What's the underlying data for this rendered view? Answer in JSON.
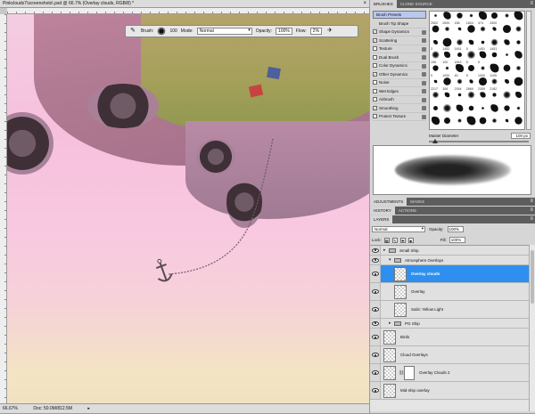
{
  "document": {
    "title": "Pinkclouds7\\screenshots\\.psd @ 66.7% (Overlay clouds, RGB/8) *",
    "close": "×",
    "status_zoom": "66.67%",
    "status_doc": "Doc: 50.0M/812.5M",
    "status_arrow": "▸"
  },
  "options_bar": {
    "brush_label": "Brush:",
    "brush_size": "100",
    "mode_label": "Mode:",
    "mode_value": "Normal",
    "opacity_label": "Opacity:",
    "opacity_value": "100%",
    "flow_label": "Flow:",
    "flow_value": "2%",
    "tool_icon": "brush-icon",
    "airbrush_icon": "airbrush-icon"
  },
  "brushes_panel": {
    "tabs": [
      "BRUSHES",
      "CLONE SOURCE"
    ],
    "presets_button": "Brush Presets",
    "options": [
      {
        "label": "Brush Tip Shape",
        "checkbox": false,
        "checked": false
      },
      {
        "label": "Shape Dynamics",
        "checkbox": true,
        "checked": true
      },
      {
        "label": "Scattering",
        "checkbox": true,
        "checked": true
      },
      {
        "label": "Texture",
        "checkbox": true,
        "checked": false
      },
      {
        "label": "Dual Brush",
        "checkbox": true,
        "checked": false
      },
      {
        "label": "Color Dynamics",
        "checkbox": true,
        "checked": false
      },
      {
        "label": "Other Dynamics",
        "checkbox": true,
        "checked": true
      },
      {
        "label": "Noise",
        "checkbox": true,
        "checked": false
      },
      {
        "label": "Wet Edges",
        "checkbox": true,
        "checked": false
      },
      {
        "label": "Airbrush",
        "checkbox": true,
        "checked": false
      },
      {
        "label": "Smoothing",
        "checkbox": true,
        "checked": true
      },
      {
        "label": "Protect Texture",
        "checkbox": true,
        "checked": false
      }
    ],
    "tip_sizes": [
      "2500",
      "2500",
      "158",
      "1804",
      "474",
      "2500",
      "",
      "",
      "",
      "",
      "",
      "",
      "",
      "",
      "",
      "",
      "3",
      "1452",
      "1451",
      "5",
      "1451",
      "1451",
      "",
      "",
      "196",
      "100",
      "1843",
      "5",
      "5",
      "",
      "",
      "",
      "9",
      "1000",
      "45",
      "5",
      "1000",
      "1105",
      "",
      "",
      "2217",
      "306",
      "2394",
      "2869",
      "2359",
      "2182",
      "",
      "",
      "",
      "",
      "",
      "",
      "",
      "",
      "",
      "",
      "",
      "",
      "",
      "",
      "",
      "",
      "",
      "",
      "",
      "",
      "",
      "",
      "",
      "",
      "",
      "",
      "",
      "",
      "",
      "",
      "",
      "",
      ""
    ],
    "master_diameter_label": "Master Diameter",
    "master_diameter_value": "100 px"
  },
  "adjustments_panel": {
    "tabs": [
      "ADJUSTMENTS",
      "MASKS"
    ]
  },
  "history_panel": {
    "tabs": [
      "HISTORY",
      "ACTIONS"
    ]
  },
  "layers_panel": {
    "tabs": [
      "LAYERS"
    ],
    "blend_mode": "Normal",
    "opacity_label": "Opacity:",
    "opacity_value": "100%",
    "lock_label": "Lock:",
    "fill_label": "Fill:",
    "fill_value": "100%",
    "layers": [
      {
        "name": "Small Ship",
        "type": "group",
        "indent": 0,
        "open": false,
        "selected": false
      },
      {
        "name": "Atmosphere Overlays",
        "type": "group",
        "indent": 1,
        "open": true,
        "selected": false
      },
      {
        "name": "Overlay clouds",
        "type": "layer",
        "indent": 2,
        "selected": true,
        "mask": false
      },
      {
        "name": "Overlay",
        "type": "layer",
        "indent": 2,
        "selected": false,
        "mask": false
      },
      {
        "name": "Sails: Yellow Light",
        "type": "layer",
        "indent": 2,
        "selected": false,
        "mask": false
      },
      {
        "name": "PG Ship",
        "type": "group",
        "indent": 1,
        "open": false,
        "selected": false
      },
      {
        "name": "Birds",
        "type": "layer",
        "indent": 0,
        "selected": false,
        "mask": false
      },
      {
        "name": "Cloud Overlays",
        "type": "layer",
        "indent": 0,
        "selected": false,
        "mask": false
      },
      {
        "name": "Overlay Clouds 2",
        "type": "layer",
        "indent": 0,
        "selected": false,
        "mask": true
      },
      {
        "name": "Mid-ship overlay",
        "type": "layer",
        "indent": 0,
        "selected": false,
        "mask": false
      }
    ]
  }
}
